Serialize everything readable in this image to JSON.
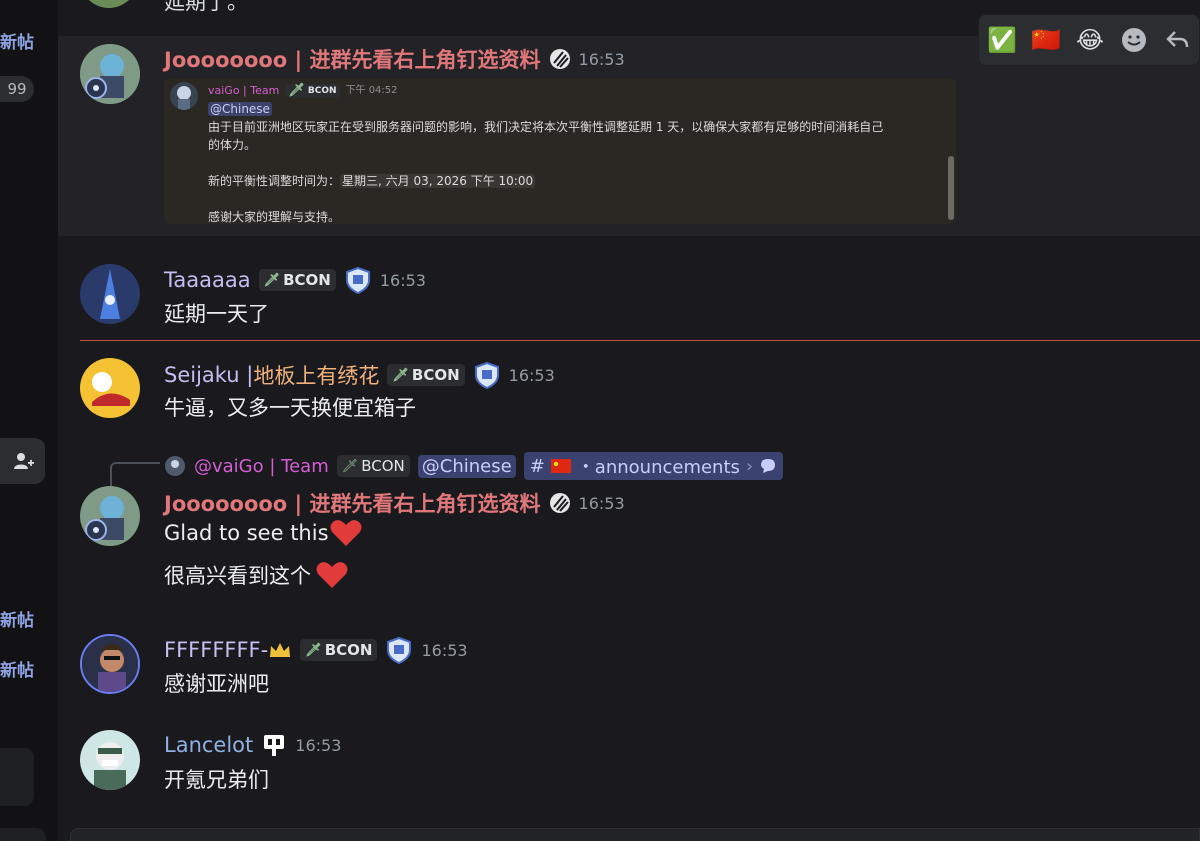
{
  "sidebar": {
    "new_post_label": "新帖",
    "unread_count": "99"
  },
  "toolbar": {
    "reactions": [
      "✅",
      "🇨🇳",
      "😂"
    ],
    "add_reaction_icon": "smile-icon",
    "reply_icon": "reply-arrow-icon"
  },
  "top_partial": {
    "text": "延期了。"
  },
  "messages": [
    {
      "username": "Joooooooo | 进群先看右上角钉选资料",
      "name_color": "#e0777b",
      "time": "16:53",
      "embed": {
        "author": "vaiGo | Team",
        "tag": "BCON",
        "time": "下午 04:52",
        "mention": "@Chinese",
        "line1": "由于目前亚洲地区玩家正在受到服务器问题的影响，我们决定将本次平衡性调整延期 1 天，以确保大家都有足够的时间消耗自己",
        "line2": "的体力。",
        "line3_prefix": "新的平衡性调整时间为：",
        "line3_date": "星期三, 六月 03, 2026 下午 10:00",
        "line4": "感谢大家的理解与支持。"
      }
    },
    {
      "username": "Taaaaaa",
      "name_color": "#c6bdf0",
      "tag": "BCON",
      "time": "16:53",
      "text": "延期一天了"
    },
    {
      "username": "Seijaku | ",
      "username_suffix": "地板上有绣花",
      "name_color": "#c6bdf0",
      "suffix_color": "#f0b27a",
      "tag": "BCON",
      "time": "16:53",
      "text": "牛逼，又多一天换便宜箱子"
    },
    {
      "reply": {
        "author": "@vaiGo | Team",
        "tag": "BCON",
        "mention": "@Chinese",
        "channel_prefix": "#",
        "channel": "・announcements",
        "channel_arrow": "›"
      },
      "username": "Joooooooo | 进群先看右上角钉选资料",
      "name_color": "#e0777b",
      "time": "16:53",
      "text": "Glad to see this",
      "text2": "很高兴看到这个"
    },
    {
      "username": "FFFFFFFF-",
      "name_color": "#c6bdf0",
      "tag": "BCON",
      "time": "16:53",
      "text": "感谢亚洲吧"
    },
    {
      "username": "Lancelot",
      "name_color": "#8fb0e0",
      "time": "16:53",
      "text": "开氪兄弟们"
    }
  ]
}
